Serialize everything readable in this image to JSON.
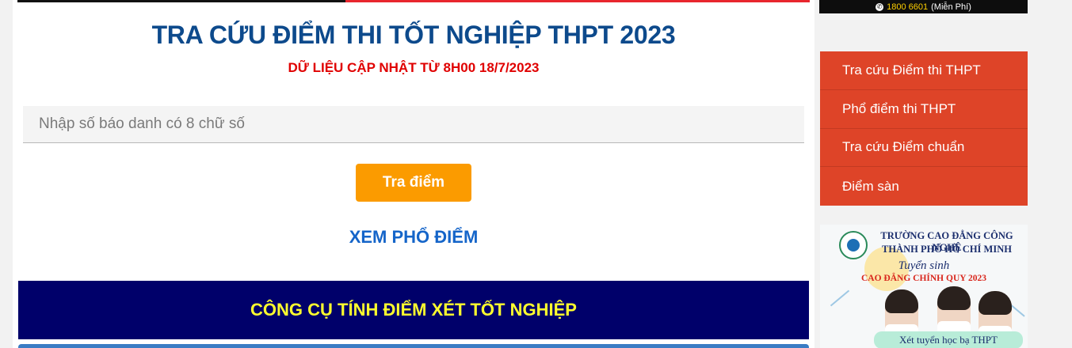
{
  "header": {
    "title": "TRA CỨU ĐIỂM THI TỐT NGHIỆP THPT 2023",
    "subtitle": "DỮ LIỆU CẬP NHẬT TỪ 8H00 18/7/2023"
  },
  "search": {
    "placeholder": "Nhập số báo danh có 8 chữ số",
    "value": "",
    "button_label": "Tra điểm"
  },
  "links": {
    "view_distribution": "XEM PHỔ ĐIỂM"
  },
  "banner": {
    "label": "CÔNG CỤ TÍNH ĐIỂM XÉT TỐT NGHIỆP"
  },
  "hotline": {
    "number": "1800 6601",
    "note": "(Miễn Phí)",
    "icon": "phone-icon"
  },
  "sidebar": {
    "items": [
      {
        "label": "Tra cứu Điểm thi THPT"
      },
      {
        "label": "Phổ điểm thi THPT"
      },
      {
        "label": "Tra cứu Điểm chuẩn"
      },
      {
        "label": "Điểm sàn"
      }
    ]
  },
  "ad": {
    "line1": "TRƯỜNG CAO ĐẲNG CÔNG NGHỆ",
    "line2": "THÀNH PHỐ HỒ CHÍ MINH",
    "tagline": "Tuyển sinh",
    "program": "CAO ĐẲNG CHÍNH QUY 2023",
    "pill": "Xét tuyển học bạ THPT"
  },
  "colors": {
    "title": "#0d4a8c",
    "subtitle": "#e00000",
    "button": "#fb9b00",
    "link": "#1565c9",
    "banner_bg": "#00006a",
    "banner_text": "#ffff2e",
    "menu_bg": "#de4428"
  }
}
